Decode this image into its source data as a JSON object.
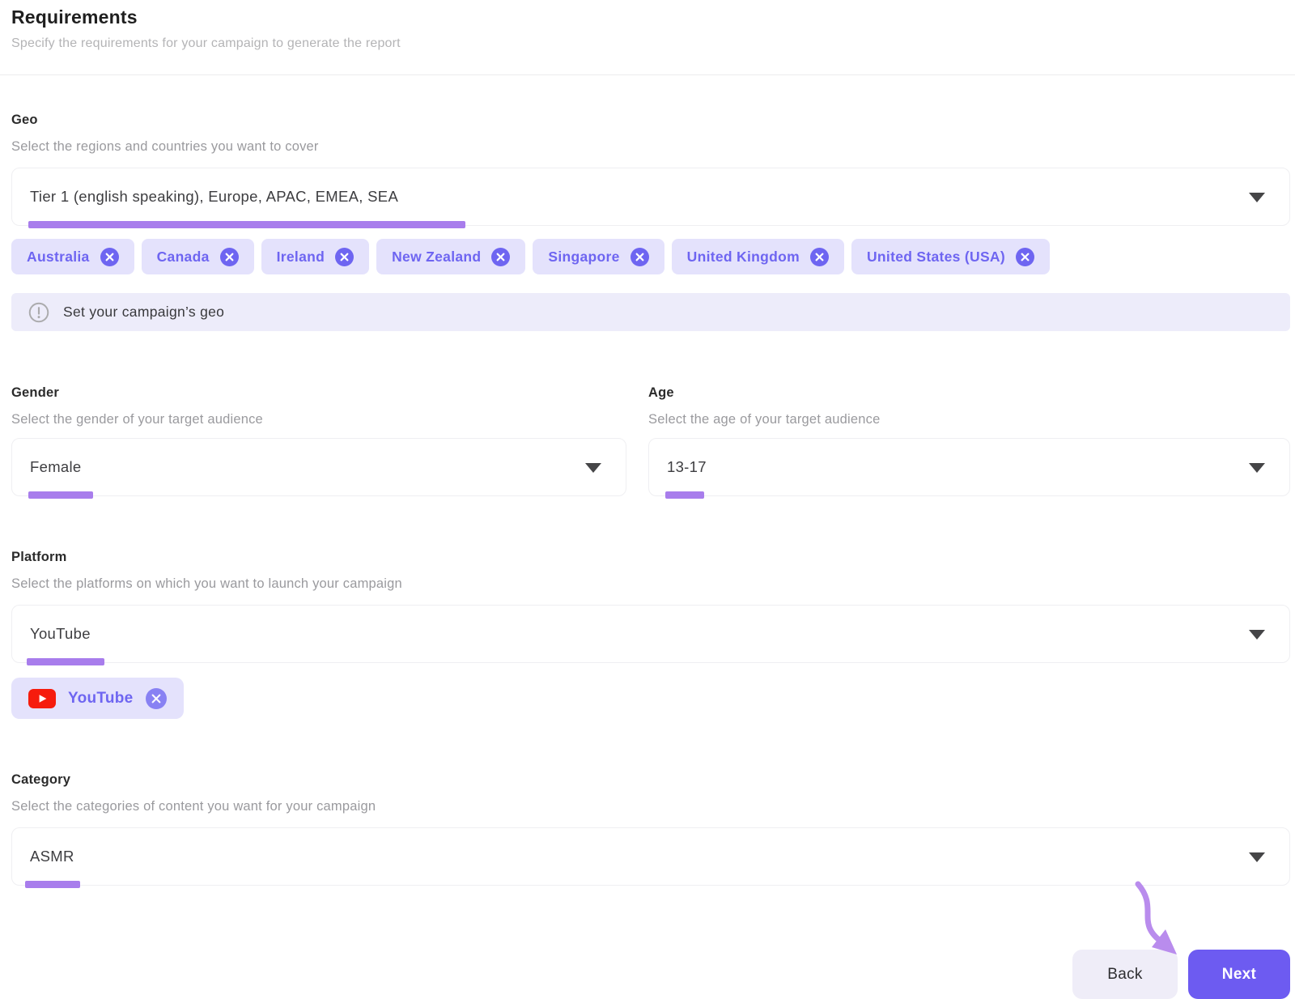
{
  "colors": {
    "accent": "#6e65f1",
    "chip_bg": "#e4e2fc",
    "notice_bg": "#edecfa",
    "underline": "#a87dec",
    "next_bg": "#6d5bf1",
    "youtube_red": "#f61c0d",
    "arrow": "#b98ced"
  },
  "header": {
    "title": "Requirements",
    "subtitle": "Specify the requirements for your campaign to generate the report"
  },
  "geo": {
    "label": "Geo",
    "description": "Select the regions and countries you want to cover",
    "value": "Tier 1 (english speaking), Europe, APAC, EMEA, SEA",
    "chips": [
      "Australia",
      "Canada",
      "Ireland",
      "New Zealand",
      "Singapore",
      "United Kingdom",
      "United States (USA)"
    ],
    "notice": "Set your campaign’s geo"
  },
  "gender": {
    "label": "Gender",
    "description": "Select the gender of your target audience",
    "value": "Female"
  },
  "age": {
    "label": "Age",
    "description": "Select the age of your target audience",
    "value": "13-17"
  },
  "platform": {
    "label": "Platform",
    "description": "Select the platforms on which you want to launch your campaign",
    "value": "YouTube",
    "chips": [
      "YouTube"
    ]
  },
  "category": {
    "label": "Category",
    "description": "Select the categories of content you want for your campaign",
    "value": "ASMR"
  },
  "footer": {
    "back_label": "Back",
    "next_label": "Next"
  }
}
